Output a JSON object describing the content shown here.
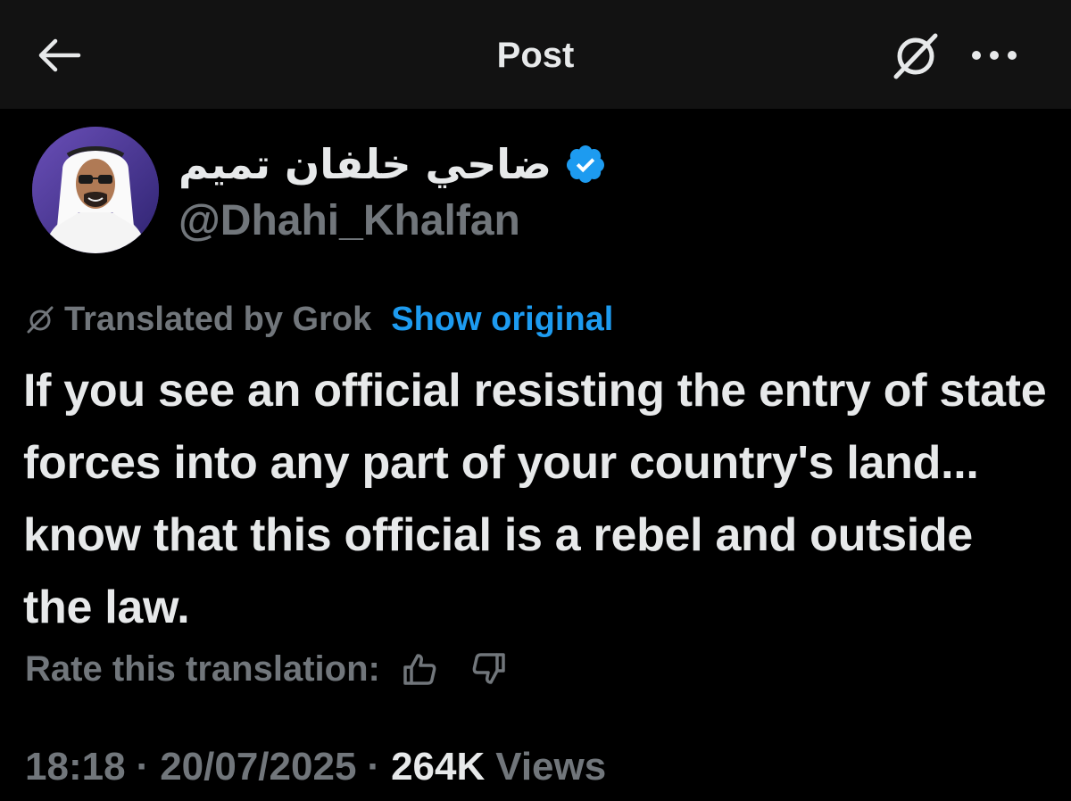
{
  "header": {
    "title": "Post",
    "back_icon": "arrow-left-icon",
    "grok_icon": "grok-icon",
    "more_icon": "more-horizontal-icon"
  },
  "author": {
    "display_name": "ضاحي خلفان تميم",
    "handle": "@Dhahi_Khalfan",
    "verified": true,
    "verified_color": "#1d9bf0"
  },
  "translation": {
    "translated_by": "Translated by Grok",
    "show_original": "Show original",
    "rate_label": "Rate this translation:",
    "thumbs_up_icon": "thumbs-up-icon",
    "thumbs_down_icon": "thumbs-down-icon"
  },
  "tweet": {
    "text": "If you see an official resisting the entry of state forces into any part of your country's land... know that this official is a rebel and outside the law."
  },
  "meta": {
    "time": "18:18",
    "date": "20/07/2025",
    "views_count": "264K",
    "views_label": "Views",
    "separator": "·"
  },
  "colors": {
    "background": "#000000",
    "header_bg": "#121212",
    "text_primary": "#e7e9ea",
    "text_secondary": "#71767b",
    "accent": "#1d9bf0"
  }
}
